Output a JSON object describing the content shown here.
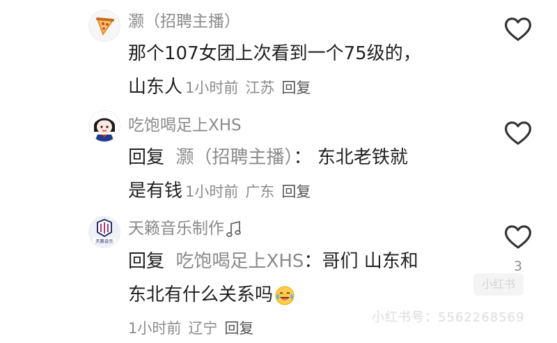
{
  "comments": [
    {
      "username": "灏（招聘主播）",
      "text_line1": "那个107女团上次看到一个75级的，",
      "text_line2": "山东人",
      "time": "1小时前",
      "location": "江苏",
      "reply_label": "回复",
      "avatar_icon": "pizza-slice-icon"
    },
    {
      "username": "吃饱喝足上XHS",
      "reply_prefix": "回复",
      "reply_target": "灏（招聘主播）",
      "reply_sep": "：",
      "text_line1": "东北老铁就",
      "text_line2": "是有钱",
      "time": "1小时前",
      "location": "广东",
      "reply_label": "回复",
      "avatar_icon": "cartoon-girl-icon"
    },
    {
      "username": "天籁音乐制作",
      "username_icon": "music-note-icon",
      "reply_prefix": "回复",
      "reply_target": "吃饱喝足上XHS",
      "reply_sep": "：",
      "text_line1": "哥们 山东和",
      "text_line2": "东北有什么关系吗",
      "text_emoji": "crying-laughing-emoji",
      "time": "1小时前",
      "location": "辽宁",
      "reply_label": "回复",
      "avatar_icon": "studio-logo-icon",
      "avatar_text": "天籁音乐",
      "like_count": "3"
    }
  ],
  "watermark": {
    "text": "小红书号：5562268569",
    "logo_text": "小红书"
  },
  "colors": {
    "secondary_text": "#8a8a8a",
    "primary_text": "#1f1f1f",
    "icon_stroke": "#333333"
  }
}
